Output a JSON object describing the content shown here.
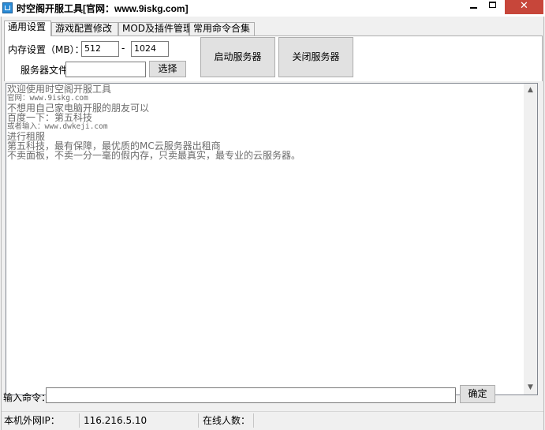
{
  "window": {
    "title": "时空阁开服工具[官网：www.9iskg.com]",
    "minimize": "",
    "maximize": "",
    "close": "✕"
  },
  "tabs": [
    {
      "label": "通用设置",
      "active": true
    },
    {
      "label": "游戏配置修改",
      "active": false
    },
    {
      "label": "MOD及插件管理",
      "active": false
    },
    {
      "label": "常用命令合集",
      "active": false
    }
  ],
  "settings": {
    "memory_label": "内存设置（MB）：",
    "memory_min": "512",
    "memory_sep": "-",
    "memory_max": "1024",
    "server_file_label": "服务器文件：",
    "server_file_value": "",
    "choose_button": "选择",
    "start_button": "启动服务器",
    "stop_button": "关闭服务器"
  },
  "console": {
    "lines": [
      "欢迎使用时空阁开服工具",
      "官网：www.9iskg.com",
      "不想用自己家电脑开服的朋友可以",
      "百度一下：第五科技",
      "或者输入：www.dwkeji.com",
      "进行租服",
      "第五科技，最有保障，最优质的MC云服务器出租商",
      "不卖面板，不卖一分一毫的假内存，只卖最真实，最专业的云服务器。"
    ],
    "scroll_up": "▲",
    "scroll_down": "▼"
  },
  "command": {
    "label": "输入命令：",
    "value": "",
    "confirm_button": "确定"
  },
  "status": {
    "ip_label": "本机外网IP：",
    "ip_value": "116.216.5.10",
    "online_label": "在线人数："
  }
}
